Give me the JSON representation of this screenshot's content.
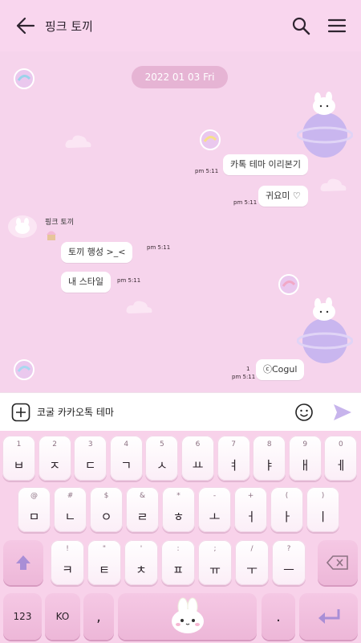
{
  "header": {
    "title": "핑크 토끼",
    "back_icon": "arrow-left-icon",
    "search_icon": "search-icon",
    "menu_icon": "hamburger-menu-icon"
  },
  "chat": {
    "date": "2022 01 03 Fri",
    "sender_name": "핑크 토끼",
    "messages": [
      {
        "side": "right",
        "text": "카톡 테마 이리본기",
        "time": "pm 5:11"
      },
      {
        "side": "right",
        "text": "귀요미 ♡",
        "time": "pm 5:11"
      },
      {
        "side": "left",
        "text": "토끼 행성 >_<",
        "time": "pm 5:11"
      },
      {
        "side": "left",
        "text": "내 스타일",
        "time": "pm 5:11"
      },
      {
        "side": "right",
        "text": "ⓒCogul",
        "time": "pm 5:11",
        "unread": "1"
      }
    ]
  },
  "input": {
    "value": "코굴 카카오톡 테마",
    "plus_icon": "plus-box-icon",
    "emoji_icon": "smiley-icon",
    "send_icon": "send-arrow-icon"
  },
  "keyboard": {
    "row1": [
      {
        "sub": "1",
        "main": "ㅂ"
      },
      {
        "sub": "2",
        "main": "ㅈ"
      },
      {
        "sub": "3",
        "main": "ㄷ"
      },
      {
        "sub": "4",
        "main": "ㄱ"
      },
      {
        "sub": "5",
        "main": "ㅅ"
      },
      {
        "sub": "6",
        "main": "ㅛ"
      },
      {
        "sub": "7",
        "main": "ㅕ"
      },
      {
        "sub": "8",
        "main": "ㅑ"
      },
      {
        "sub": "9",
        "main": "ㅐ"
      },
      {
        "sub": "0",
        "main": "ㅔ"
      }
    ],
    "row2": [
      {
        "sub": "@",
        "main": "ㅁ"
      },
      {
        "sub": "#",
        "main": "ㄴ"
      },
      {
        "sub": "$",
        "main": "ㅇ"
      },
      {
        "sub": "&",
        "main": "ㄹ"
      },
      {
        "sub": "*",
        "main": "ㅎ"
      },
      {
        "sub": "-",
        "main": "ㅗ"
      },
      {
        "sub": "+",
        "main": "ㅓ"
      },
      {
        "sub": "(",
        "main": "ㅏ"
      },
      {
        "sub": ")",
        "main": "ㅣ"
      }
    ],
    "row3": [
      {
        "sub": "!",
        "main": "ㅋ"
      },
      {
        "sub": "\"",
        "main": "ㅌ"
      },
      {
        "sub": "'",
        "main": "ㅊ"
      },
      {
        "sub": ":",
        "main": "ㅍ"
      },
      {
        "sub": ";",
        "main": "ㅠ"
      },
      {
        "sub": "/",
        "main": "ㅜ"
      },
      {
        "sub": "?",
        "main": "ㅡ"
      }
    ],
    "shift_icon": "shift-arrow-icon",
    "backspace_icon": "backspace-icon",
    "bottom": {
      "numbers_label": "123",
      "language_label": "KO",
      "comma_label": ",",
      "space_icon": "bunny-face-icon",
      "period_label": ".",
      "enter_icon": "enter-return-icon"
    }
  },
  "colors": {
    "background": "#f6d4ec",
    "accent": "#b9a2e6",
    "func_key": "#f0bde0"
  }
}
